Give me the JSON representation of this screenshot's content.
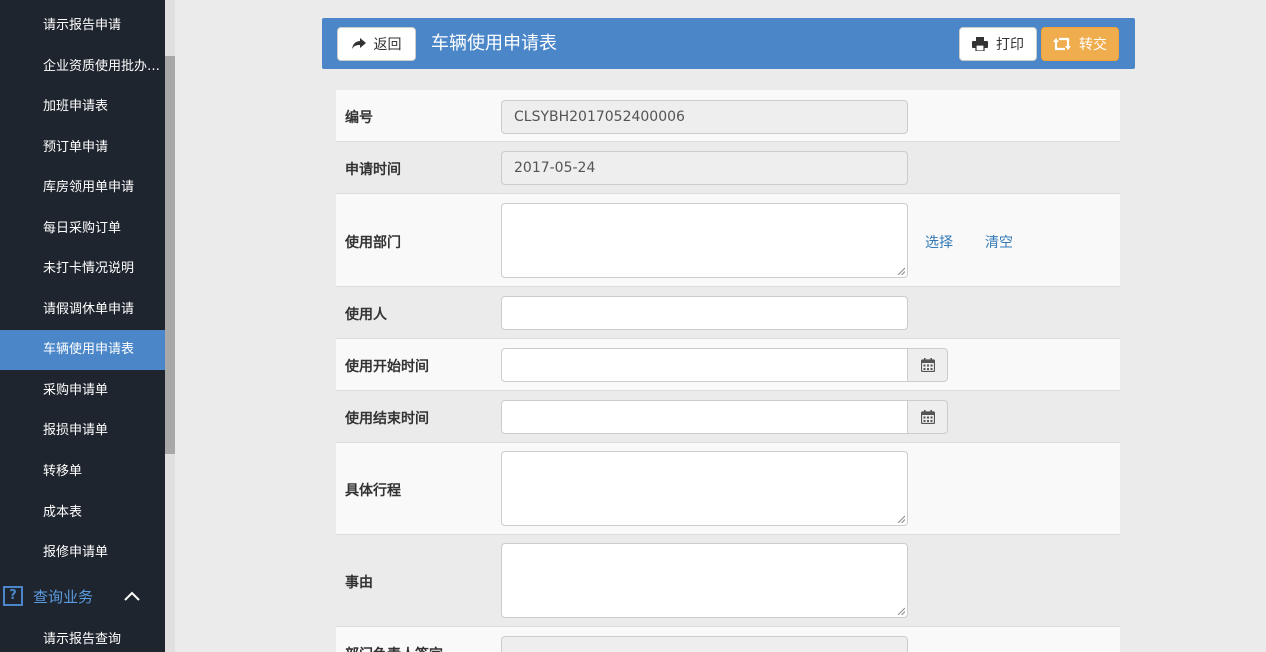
{
  "sidebar": {
    "items": [
      {
        "label": "请示报告申请"
      },
      {
        "label": "企业资质使用批办单申请"
      },
      {
        "label": "加班申请表"
      },
      {
        "label": "预订单申请"
      },
      {
        "label": "库房领用单申请"
      },
      {
        "label": "每日采购订单"
      },
      {
        "label": "未打卡情况说明"
      },
      {
        "label": "请假调休单申请"
      },
      {
        "label": "车辆使用申请表"
      },
      {
        "label": "采购申请单"
      },
      {
        "label": "报损申请单"
      },
      {
        "label": "转移单"
      },
      {
        "label": "成本表"
      },
      {
        "label": "报修申请单"
      }
    ],
    "active_item": "车辆使用申请表",
    "section": {
      "icon_text": "?",
      "label": "查询业务"
    },
    "section_items": [
      {
        "label": "请示报告查询"
      }
    ]
  },
  "header": {
    "back_label": "返回",
    "title": "车辆使用申请表",
    "print_label": "打印",
    "transfer_label": "转交"
  },
  "form": {
    "rows": [
      {
        "label": "编号",
        "value": "CLSYBH2017052400006"
      },
      {
        "label": "申请时间",
        "value": "2017-05-24"
      },
      {
        "label": "使用部门",
        "value": "",
        "select_link": "选择",
        "clear_link": "清空"
      },
      {
        "label": "使用人",
        "value": ""
      },
      {
        "label": "使用开始时间",
        "value": ""
      },
      {
        "label": "使用结束时间",
        "value": ""
      },
      {
        "label": "具体行程",
        "value": ""
      },
      {
        "label": "事由",
        "value": ""
      },
      {
        "label": "部门负责人签字",
        "value": ""
      }
    ]
  },
  "colors": {
    "sidebar_bg": "#1f252e",
    "accent": "#4a86c8",
    "warning": "#f0ad4e",
    "link": "#337ab7"
  }
}
